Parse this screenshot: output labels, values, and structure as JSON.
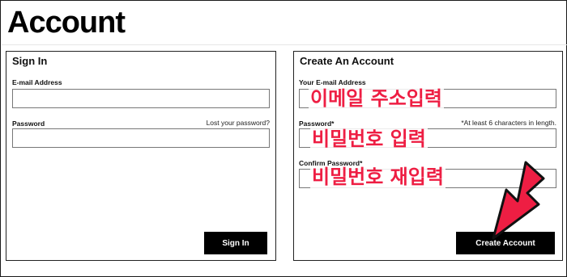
{
  "page": {
    "title": "Account"
  },
  "sign_in": {
    "heading": "Sign In",
    "email_label": "E-mail Address",
    "email_value": "",
    "password_label": "Password",
    "password_value": "",
    "lost_password_link": "Lost your password?",
    "submit_label": "Sign In"
  },
  "create_account": {
    "heading": "Create An Account",
    "email_label": "Your E-mail Address",
    "email_value": "",
    "password_label": "Password*",
    "password_hint": "*At least 6 characters in length.",
    "password_value": "",
    "confirm_label": "Confirm Password*",
    "confirm_value": "",
    "submit_label": "Create Account"
  },
  "annotations": {
    "email_note": "이메일 주소입력",
    "password_note": "비밀번호 입력",
    "confirm_note": "비밀번호 재입력",
    "arrow_icon": "pointing-arrow-icon",
    "accent_color": "#ee1e43"
  }
}
